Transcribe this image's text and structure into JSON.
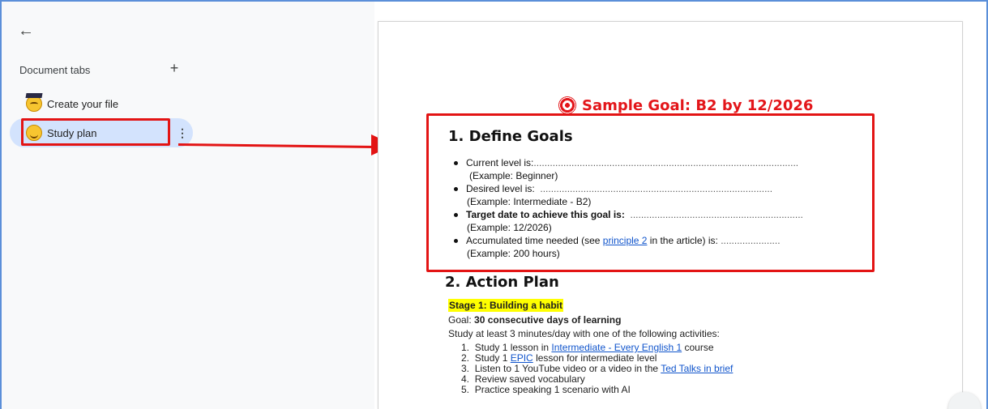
{
  "sidebar": {
    "back_icon": "arrow-left-icon",
    "heading": "Document tabs",
    "add_label": "+",
    "tabs": [
      {
        "label": "Create your file",
        "icon": "thinking-face-emoji-icon",
        "active": false
      },
      {
        "label": "Study plan",
        "icon": "smiling-face-emoji-icon",
        "active": true
      }
    ],
    "more_label": "⋮"
  },
  "annotation": {
    "color": "#e31414"
  },
  "document": {
    "title": "Sample Goal: B2 by 12/2026",
    "title_color": "#e3161a",
    "section1": {
      "heading": "1. Define Goals",
      "items": [
        {
          "label": "Current level is:",
          "dots": "..................................................................................................",
          "example": "(Example: Beginner)"
        },
        {
          "label": "Desired level is:",
          "dots": "......................................................................................",
          "example": "(Example: Intermediate - B2)"
        },
        {
          "label": "Target date to achieve this goal is:",
          "dots": "................................................................",
          "example": "(Example: 12/2026)"
        },
        {
          "label_before": "Accumulated time needed (see ",
          "link": "principle 2",
          "label_after": " in the article) is:",
          "dots": "......................",
          "example": "(Example: 200 hours)"
        }
      ]
    },
    "section2": {
      "heading": "2. Action Plan",
      "stage": "Stage 1: Building a habit",
      "goal_prefix": "Goal: ",
      "goal_bold": "30 consecutive days of learning",
      "intro": "Study at least 3 minutes/day with one of the following activities:",
      "list": [
        {
          "num": "1.",
          "before": "Study 1 lesson in ",
          "link": "Intermediate - Every English 1",
          "after": " course"
        },
        {
          "num": "2.",
          "before": "Study 1 ",
          "link": "EPIC",
          "after": " lesson for intermediate level"
        },
        {
          "num": "3.",
          "before": "Listen to 1 YouTube video or a video in the ",
          "link": "Ted Talks in brief",
          "after": ""
        },
        {
          "num": "4.",
          "before": "Review saved vocabulary",
          "link": "",
          "after": ""
        },
        {
          "num": "5.",
          "before": "Practice speaking 1 scenario with AI",
          "link": "",
          "after": ""
        }
      ]
    }
  }
}
